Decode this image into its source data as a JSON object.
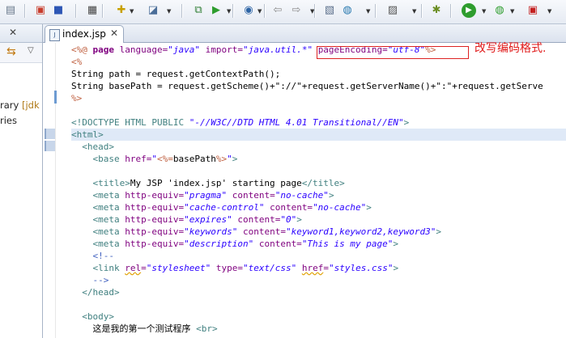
{
  "toolbar": {
    "icons": [
      "toolbox-icon",
      "save-all-icon",
      "print-icon",
      "new-wizard-icon",
      "deploy-icon",
      "server-icon",
      "open-type-icon",
      "open-perspective-icon",
      "web-browser-icon",
      "previous-edit-icon",
      "next-edit-icon",
      "open-resource-icon",
      "globe-icon",
      "image-icon",
      "debug-icon",
      "run-icon",
      "run-external-icon",
      "stop-server-icon"
    ]
  },
  "left_panel": {
    "close_glyph": "✕",
    "rows": [
      {
        "text": "rary ",
        "suffix": "[jdk"
      },
      {
        "text": "ries",
        "suffix": ""
      }
    ]
  },
  "editor": {
    "tab_label": "index.jsp",
    "tab_close": "✕",
    "annotation": "改写编码格式.",
    "lines": [
      {
        "segs": [
          {
            "c": "jsp",
            "t": "<%@ "
          },
          {
            "c": "bold attr",
            "t": "page "
          },
          {
            "c": "attr",
            "t": "language="
          },
          {
            "c": "val",
            "t": "\"java\""
          },
          {
            "c": "",
            "t": " "
          },
          {
            "c": "attr",
            "t": "import="
          },
          {
            "c": "val",
            "t": "\"java.util.*\""
          },
          {
            "c": "",
            "t": " "
          },
          {
            "c": "attr",
            "t": "pageEncoding="
          },
          {
            "c": "val",
            "t": "\"utf-8\""
          },
          {
            "c": "jsp",
            "t": "%>"
          }
        ]
      },
      {
        "segs": [
          {
            "c": "jsp",
            "t": "<%"
          }
        ]
      },
      {
        "segs": [
          {
            "c": "",
            "t": "String path = request.getContextPath();"
          }
        ]
      },
      {
        "segs": [
          {
            "c": "",
            "t": "String basePath = request.getScheme()+\"://\"+request.getServerName()+\":\"+request.getServe"
          }
        ]
      },
      {
        "segs": [
          {
            "c": "jsp",
            "t": "%>"
          }
        ]
      },
      {
        "segs": []
      },
      {
        "segs": [
          {
            "c": "tag",
            "t": "<!DOCTYPE HTML PUBLIC "
          },
          {
            "c": "val",
            "t": "\"-//W3C//DTD HTML 4.01 Transitional//EN\""
          },
          {
            "c": "tag",
            "t": ">"
          }
        ]
      },
      {
        "segs": [
          {
            "c": "tag",
            "t": "<html>"
          }
        ],
        "hl": true
      },
      {
        "segs": [
          {
            "c": "",
            "t": "  "
          },
          {
            "c": "tag",
            "t": "<head>"
          }
        ]
      },
      {
        "segs": [
          {
            "c": "",
            "t": "    "
          },
          {
            "c": "tag",
            "t": "<base "
          },
          {
            "c": "attr",
            "t": "href="
          },
          {
            "c": "val",
            "t": "\""
          },
          {
            "c": "jsp",
            "t": "<%="
          },
          {
            "c": "",
            "t": "basePath"
          },
          {
            "c": "jsp",
            "t": "%>"
          },
          {
            "c": "val",
            "t": "\""
          },
          {
            "c": "tag",
            "t": ">"
          }
        ]
      },
      {
        "segs": []
      },
      {
        "segs": [
          {
            "c": "",
            "t": "    "
          },
          {
            "c": "tag",
            "t": "<title>"
          },
          {
            "c": "",
            "t": "My JSP 'index.jsp' starting page"
          },
          {
            "c": "tag",
            "t": "</title>"
          }
        ]
      },
      {
        "segs": [
          {
            "c": "",
            "t": "    "
          },
          {
            "c": "tag",
            "t": "<meta "
          },
          {
            "c": "attr",
            "t": "http-equiv="
          },
          {
            "c": "val",
            "t": "\"pragma\""
          },
          {
            "c": "",
            "t": " "
          },
          {
            "c": "attr",
            "t": "content="
          },
          {
            "c": "val",
            "t": "\"no-cache\""
          },
          {
            "c": "tag",
            "t": ">"
          }
        ]
      },
      {
        "segs": [
          {
            "c": "",
            "t": "    "
          },
          {
            "c": "tag",
            "t": "<meta "
          },
          {
            "c": "attr",
            "t": "http-equiv="
          },
          {
            "c": "val",
            "t": "\"cache-control\""
          },
          {
            "c": "",
            "t": " "
          },
          {
            "c": "attr",
            "t": "content="
          },
          {
            "c": "val",
            "t": "\"no-cache\""
          },
          {
            "c": "tag",
            "t": ">"
          }
        ]
      },
      {
        "segs": [
          {
            "c": "",
            "t": "    "
          },
          {
            "c": "tag",
            "t": "<meta "
          },
          {
            "c": "attr",
            "t": "http-equiv="
          },
          {
            "c": "val",
            "t": "\"expires\""
          },
          {
            "c": "",
            "t": " "
          },
          {
            "c": "attr",
            "t": "content="
          },
          {
            "c": "val",
            "t": "\"0\""
          },
          {
            "c": "tag",
            "t": ">"
          }
        ]
      },
      {
        "segs": [
          {
            "c": "",
            "t": "    "
          },
          {
            "c": "tag",
            "t": "<meta "
          },
          {
            "c": "attr",
            "t": "http-equiv="
          },
          {
            "c": "val",
            "t": "\"keywords\""
          },
          {
            "c": "",
            "t": " "
          },
          {
            "c": "attr",
            "t": "content="
          },
          {
            "c": "val",
            "t": "\"keyword1,keyword2,keyword3\""
          },
          {
            "c": "tag",
            "t": ">"
          }
        ]
      },
      {
        "segs": [
          {
            "c": "",
            "t": "    "
          },
          {
            "c": "tag",
            "t": "<meta "
          },
          {
            "c": "attr",
            "t": "http-equiv="
          },
          {
            "c": "val",
            "t": "\"description\""
          },
          {
            "c": "",
            "t": " "
          },
          {
            "c": "attr",
            "t": "content="
          },
          {
            "c": "val",
            "t": "\"This is my page\""
          },
          {
            "c": "tag",
            "t": ">"
          }
        ]
      },
      {
        "segs": [
          {
            "c": "",
            "t": "    "
          },
          {
            "c": "cmt",
            "t": "<!--"
          }
        ]
      },
      {
        "segs": [
          {
            "c": "",
            "t": "    "
          },
          {
            "c": "tag",
            "t": "<link "
          },
          {
            "c": "attr squig",
            "t": "rel"
          },
          {
            "c": "attr",
            "t": "="
          },
          {
            "c": "val",
            "t": "\"stylesheet\""
          },
          {
            "c": "",
            "t": " "
          },
          {
            "c": "attr",
            "t": "type="
          },
          {
            "c": "val",
            "t": "\"text/css\""
          },
          {
            "c": "",
            "t": " "
          },
          {
            "c": "attr squig",
            "t": "href"
          },
          {
            "c": "attr",
            "t": "="
          },
          {
            "c": "val",
            "t": "\"styles.css\""
          },
          {
            "c": "tag",
            "t": ">"
          }
        ]
      },
      {
        "segs": [
          {
            "c": "",
            "t": "    "
          },
          {
            "c": "cmt",
            "t": "-->"
          }
        ]
      },
      {
        "segs": [
          {
            "c": "",
            "t": "  "
          },
          {
            "c": "tag",
            "t": "</head>"
          }
        ]
      },
      {
        "segs": []
      },
      {
        "segs": [
          {
            "c": "",
            "t": "  "
          },
          {
            "c": "tag",
            "t": "<body>"
          }
        ]
      },
      {
        "segs": [
          {
            "c": "",
            "t": "    这是我的第一个测试程序 "
          },
          {
            "c": "tag",
            "t": "<br>"
          }
        ]
      }
    ]
  }
}
